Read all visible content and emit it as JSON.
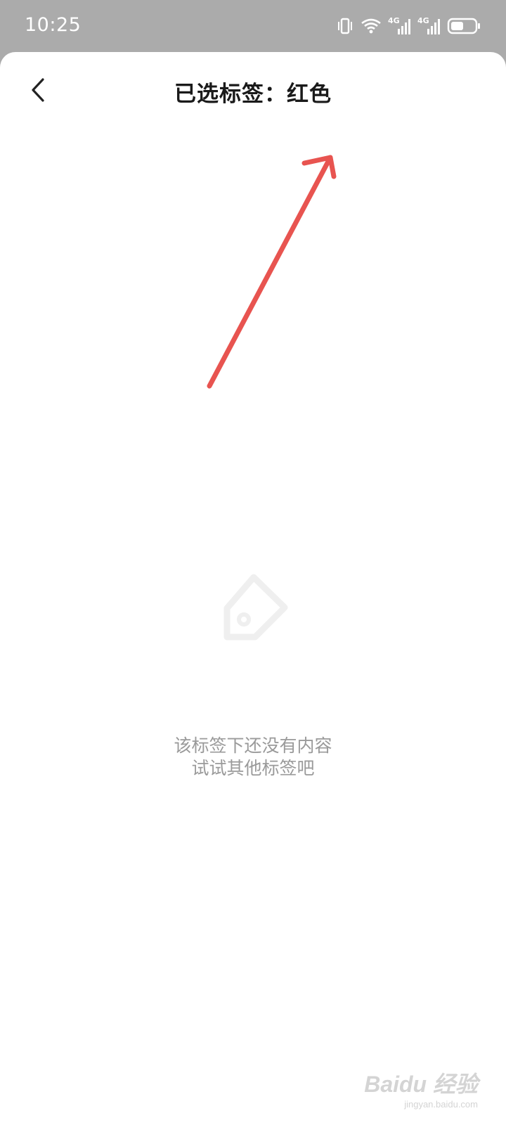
{
  "status_bar": {
    "time": "10:25",
    "icons": [
      "vibrate-icon",
      "wifi-icon",
      "signal-4g-icon",
      "signal-4g-icon",
      "battery-icon"
    ],
    "network_label_1": "4G",
    "network_label_2": "4G"
  },
  "header": {
    "back_icon": "chevron-left-icon",
    "title": "已选标签：红色"
  },
  "annotation": {
    "arrow_color": "#e85450"
  },
  "empty_state": {
    "icon": "tag-icon",
    "line1": "该标签下还没有内容",
    "line2": "试试其他标签吧"
  },
  "watermark": {
    "brand": "Baidu 经验",
    "url": "jingyan.baidu.com"
  }
}
